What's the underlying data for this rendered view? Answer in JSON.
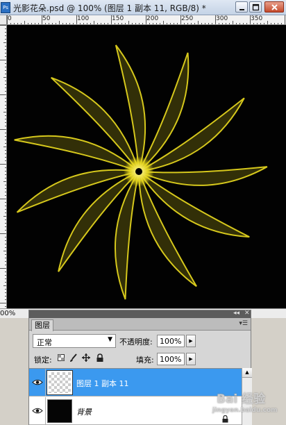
{
  "window": {
    "title": "光影花朵.psd @ 100% (图层 1 副本 11, RGB/8) *",
    "app_icon": "photoshop-file-icon",
    "controls": [
      "minimize-icon",
      "maximize-icon",
      "close-icon"
    ]
  },
  "rulers": {
    "horizontal_labels": [
      "0",
      "50",
      "100",
      "150",
      "200",
      "250",
      "300",
      "350"
    ],
    "unit": "px"
  },
  "canvas": {
    "background": "#020202",
    "artwork": "yellow glowing petal flower",
    "accent": "#e0d21e"
  },
  "status": {
    "zoom": "00%"
  },
  "layers_panel": {
    "tab": "图层",
    "blend_mode": "正常",
    "opacity_label": "不透明度:",
    "opacity_value": "100%",
    "lock_label": "锁定:",
    "lock_icons": [
      "lock-transparent-icon",
      "lock-brush-icon",
      "lock-move-icon",
      "lock-all-icon"
    ],
    "fill_label": "填充:",
    "fill_value": "100%",
    "selected_color": "#3b99ef",
    "layers": [
      {
        "name": "图层 1 副本 11",
        "visible": true,
        "selected": true,
        "thumbnail": "transparent"
      },
      {
        "name": "背景",
        "visible": true,
        "selected": false,
        "thumbnail": "black",
        "locked": true
      }
    ]
  },
  "watermark": {
    "text": "Bai 经验",
    "subtext": "jingyan.baidu.com"
  }
}
